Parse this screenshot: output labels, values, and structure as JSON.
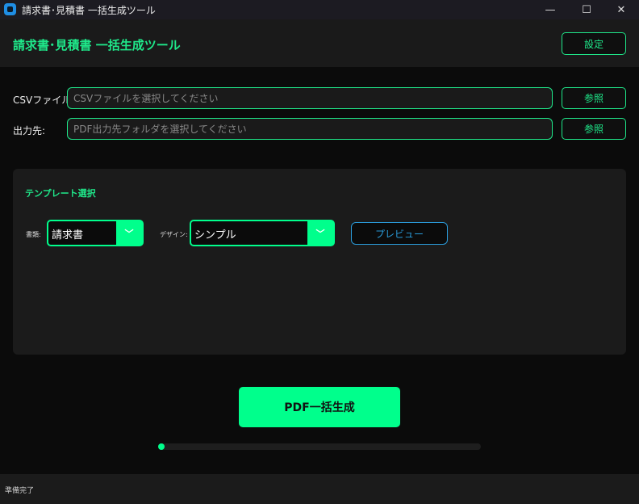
{
  "window": {
    "title": "請求書･見積書 一括生成ツール",
    "minimize": "—",
    "maximize": "☐",
    "close": "✕"
  },
  "header": {
    "title": "請求書･見積書 一括生成ツール",
    "settings_label": "設定"
  },
  "files": {
    "csv_label": "CSVファイル:",
    "csv_placeholder": "CSVファイルを選択してください",
    "csv_browse": "参照",
    "out_label": "出力先:",
    "out_placeholder": "PDF出力先フォルダを選択してください",
    "out_browse": "参照"
  },
  "template": {
    "title": "テンプレート選択",
    "doc_type_label": "書類:",
    "doc_type_value": "請求書",
    "design_label": "デザイン:",
    "design_value": "シンプル",
    "preview_label": "プレビュー"
  },
  "actions": {
    "generate_label": "PDF一括生成"
  },
  "progress": {
    "value": 0
  },
  "status": {
    "text": "準備完了"
  },
  "colors": {
    "accent": "#00ff8c",
    "preview": "#2a9ad8"
  }
}
